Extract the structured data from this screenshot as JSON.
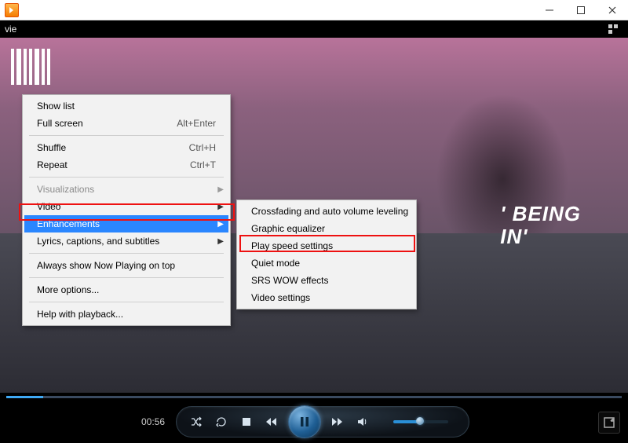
{
  "subbar": {
    "title": "vie"
  },
  "context_menu": {
    "items": [
      {
        "label": "Show list",
        "shortcut": "",
        "has_sub": false,
        "disabled": false
      },
      {
        "label": "Full screen",
        "shortcut": "Alt+Enter",
        "has_sub": false,
        "disabled": false
      },
      {
        "sep": true
      },
      {
        "label": "Shuffle",
        "shortcut": "Ctrl+H",
        "has_sub": false,
        "disabled": false
      },
      {
        "label": "Repeat",
        "shortcut": "Ctrl+T",
        "has_sub": false,
        "disabled": false
      },
      {
        "sep": true
      },
      {
        "label": "Visualizations",
        "shortcut": "",
        "has_sub": true,
        "disabled": true
      },
      {
        "label": "Video",
        "shortcut": "",
        "has_sub": true,
        "disabled": false
      },
      {
        "label": "Enhancements",
        "shortcut": "",
        "has_sub": true,
        "disabled": false,
        "selected": true
      },
      {
        "label": "Lyrics, captions, and subtitles",
        "shortcut": "",
        "has_sub": true,
        "disabled": false
      },
      {
        "sep": true
      },
      {
        "label": "Always show Now Playing on top",
        "shortcut": "",
        "has_sub": false,
        "disabled": false
      },
      {
        "sep": true
      },
      {
        "label": "More options...",
        "shortcut": "",
        "has_sub": false,
        "disabled": false
      },
      {
        "sep": true
      },
      {
        "label": "Help with playback...",
        "shortcut": "",
        "has_sub": false,
        "disabled": false
      }
    ]
  },
  "submenu": {
    "items": [
      {
        "label": "Crossfading and auto volume leveling"
      },
      {
        "label": "Graphic equalizer"
      },
      {
        "label": "Play speed settings",
        "highlight": true
      },
      {
        "label": "Quiet mode"
      },
      {
        "label": "SRS WOW effects"
      },
      {
        "label": "Video settings"
      }
    ]
  },
  "overlay_text": {
    "line1": "' BEING",
    "line2": "IN'"
  },
  "playback": {
    "time_elapsed": "00:56",
    "progress_pct": 6,
    "volume_pct": 48
  }
}
